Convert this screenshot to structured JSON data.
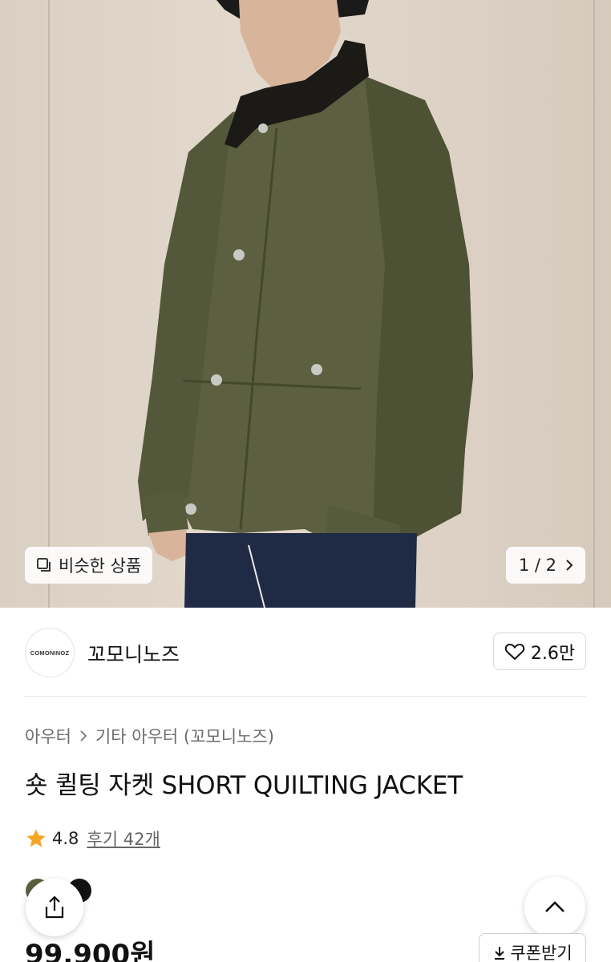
{
  "hero": {
    "similar_label": "비슷한 상품",
    "pager_text": "1 / 2"
  },
  "brand": {
    "logo_text": "COMONINOZ",
    "name": "꼬모니노즈",
    "likes": "2.6만"
  },
  "breadcrumb": [
    "아우터",
    "기타 아우터 (꼬모니노즈)"
  ],
  "product": {
    "title": "숏 퀼팅 자켓 SHORT QUILTING JACKET",
    "rating": "4.8",
    "review_text": "후기 42개",
    "price": "99,900원"
  },
  "coupon": {
    "label": "쿠폰받기"
  },
  "colors": {
    "jacket": "#5c6040",
    "collar": "#1c1a17",
    "star": "#f5a623",
    "wall": "#ddd2c5"
  }
}
